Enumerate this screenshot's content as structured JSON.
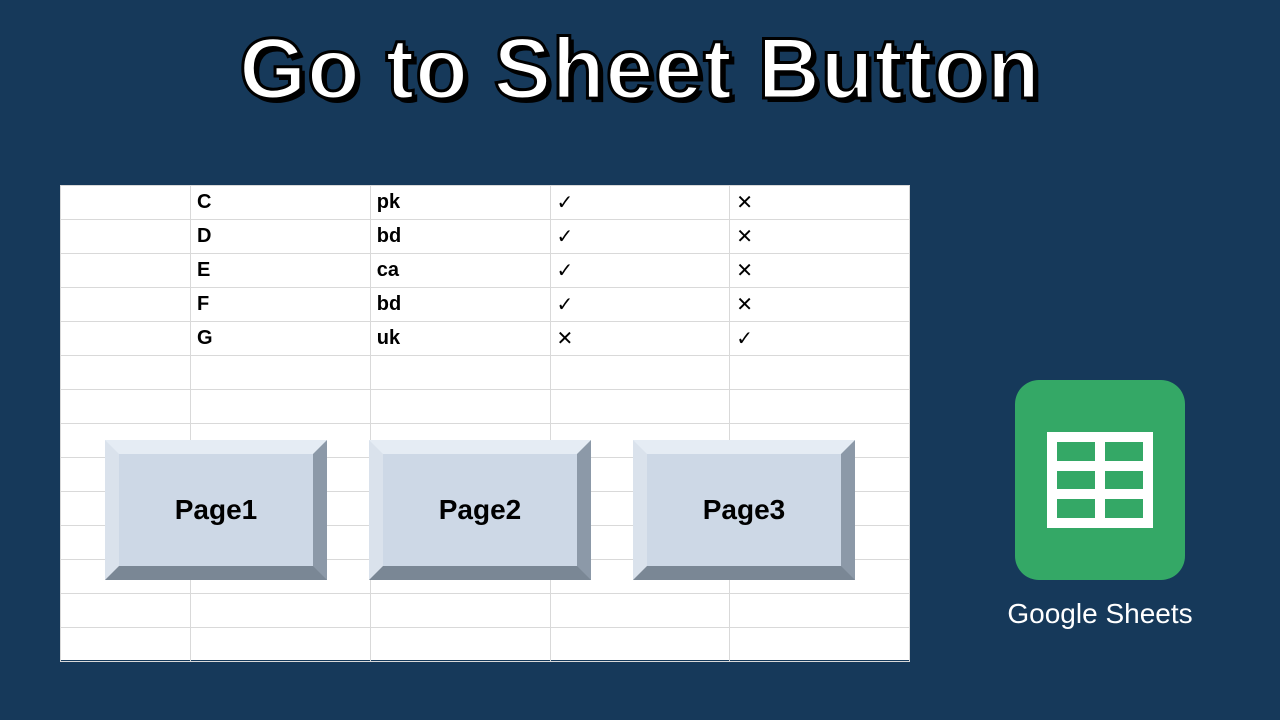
{
  "title": "Go to Sheet Button",
  "sidebar": {
    "label": "Google Sheets"
  },
  "table": {
    "rows": [
      {
        "c0": "C",
        "c1": "pk",
        "c2": "✓",
        "c3": "✕"
      },
      {
        "c0": "D",
        "c1": "bd",
        "c2": "✓",
        "c3": "✕"
      },
      {
        "c0": "E",
        "c1": "ca",
        "c2": "✓",
        "c3": "✕"
      },
      {
        "c0": "F",
        "c1": "bd",
        "c2": "✓",
        "c3": "✕"
      },
      {
        "c0": "G",
        "c1": "uk",
        "c2": "✕",
        "c3": "✓"
      }
    ]
  },
  "buttons": {
    "page1": "Page1",
    "page2": "Page2",
    "page3": "Page3"
  }
}
